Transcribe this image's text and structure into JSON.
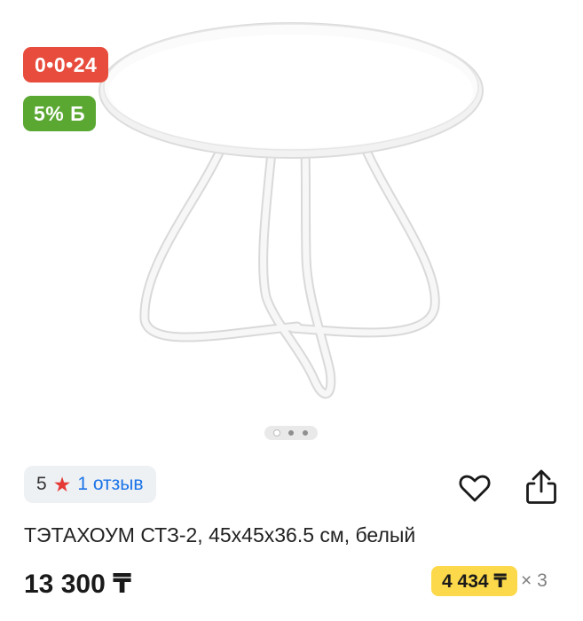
{
  "badges": {
    "timer": "0•0•24",
    "bonus": "5% Б"
  },
  "gallery": {
    "image_count": 3,
    "active_index": 0,
    "product_color": "#ffffff"
  },
  "rating": {
    "score": "5",
    "star_icon": "star-icon",
    "reviews": "1 отзыв"
  },
  "actions": {
    "favorite_icon": "heart-icon",
    "share_icon": "share-icon"
  },
  "product": {
    "title": "ТЭТАХОУМ СТЗ-2, 45х45х36.5 см, белый",
    "price": "13 300 ₸",
    "installment_price": "4 434 ₸",
    "installment_months": "× 3"
  },
  "colors": {
    "timer_badge": "#e74c3c",
    "bonus_badge": "#5aa832",
    "link": "#1a73e8",
    "star": "#e53935",
    "installment_chip": "#fcd94a"
  }
}
